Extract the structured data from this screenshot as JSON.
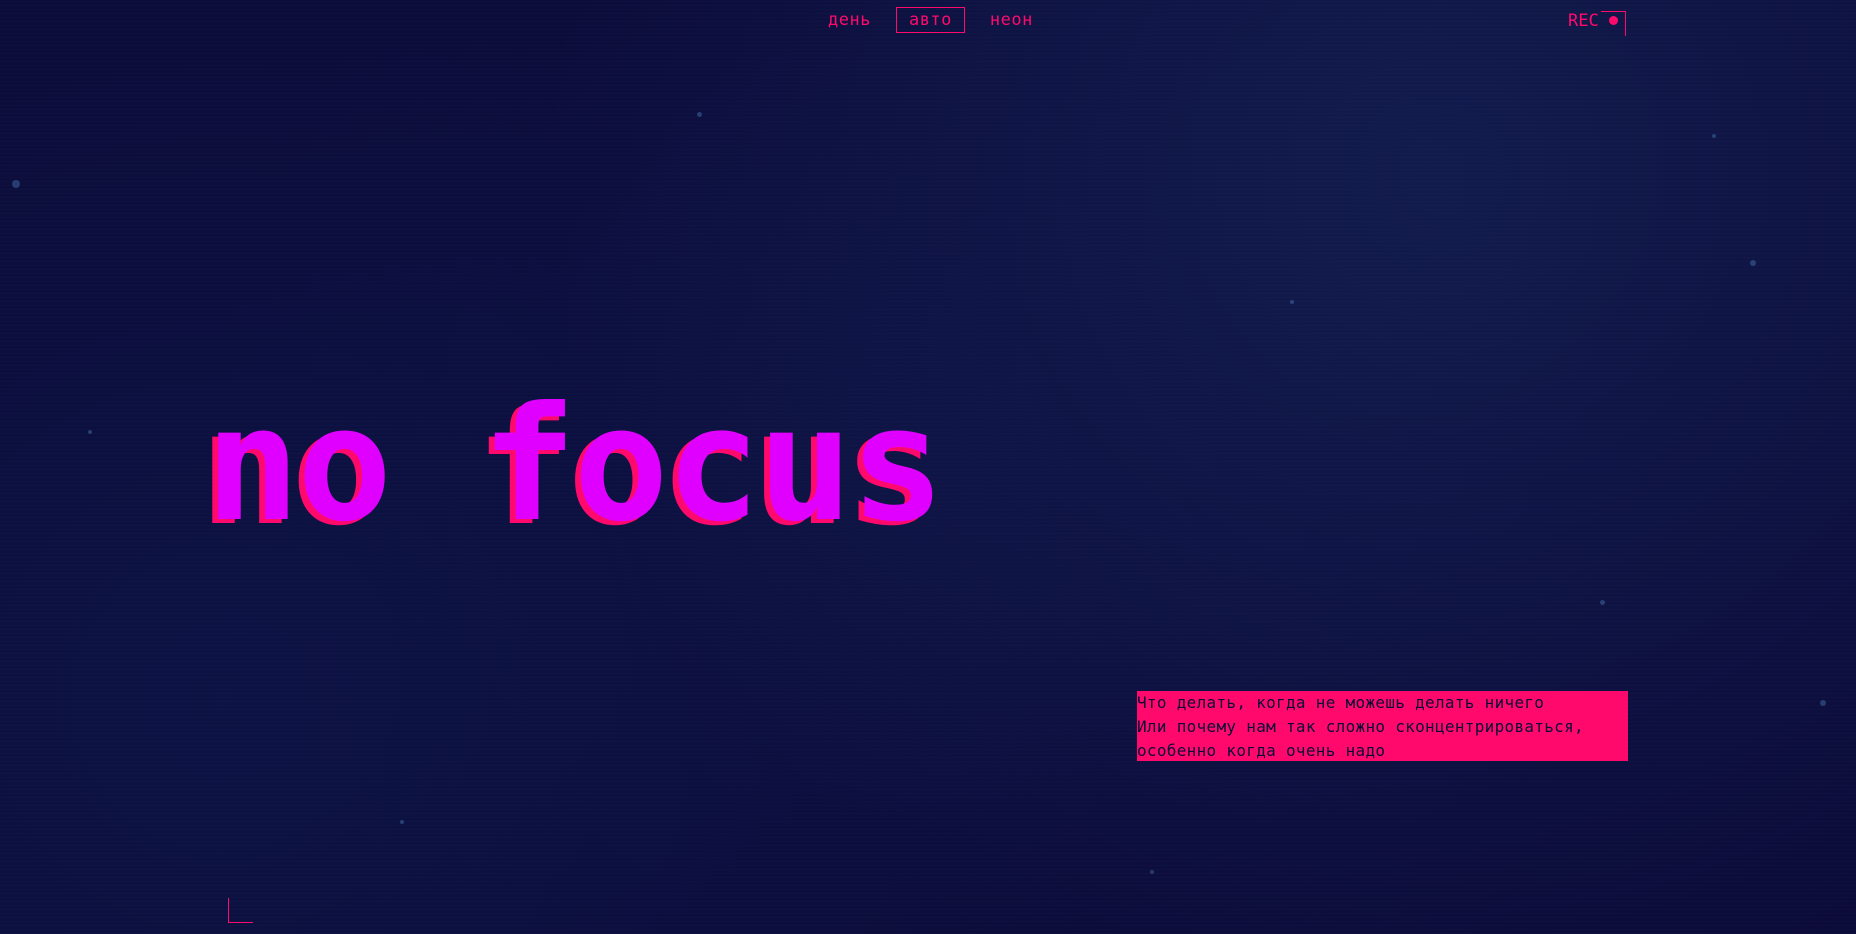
{
  "theme_switch": {
    "options": [
      {
        "label": "день",
        "active": false
      },
      {
        "label": "авто",
        "active": true
      },
      {
        "label": "неон",
        "active": false
      }
    ]
  },
  "recorder": {
    "label": "REC",
    "icon": "record-dot-icon"
  },
  "hero": {
    "title": "no focus"
  },
  "subtitle": {
    "lines": [
      "Что делать, когда не можешь делать ничего",
      "Или почему нам так сложно сконцентрироваться,",
      "особенно когда очень надо"
    ]
  },
  "colors": {
    "background": "#0b0a38",
    "accent": "#ff0a6c",
    "title": "#e000ff"
  }
}
